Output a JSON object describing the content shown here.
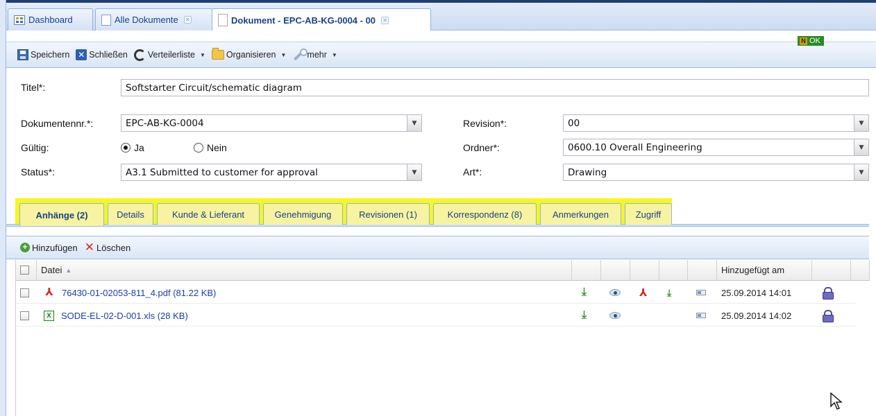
{
  "window_tabs": [
    {
      "label": "Dashboard",
      "icon": "dashboard-icon",
      "closable": false
    },
    {
      "label": "Alle Dokumente",
      "icon": "documents-icon",
      "closable": true
    },
    {
      "label": "Dokument - EPC-AB-KG-0004 - 00",
      "icon": "page-icon",
      "closable": true,
      "active": true
    }
  ],
  "status_badge": {
    "letter": "N",
    "text": "OK",
    "color": "#2a8a26"
  },
  "toolbar": {
    "save": "Speichern",
    "close": "Schließen",
    "distribution": "Verteilerliste",
    "organize": "Organisieren",
    "more": "mehr"
  },
  "form": {
    "title_label": "Titel*:",
    "title_value": "Softstarter Circuit/schematic diagram",
    "docnr_label": "Dokumentennr.*:",
    "docnr_value": "EPC-AB-KG-0004",
    "valid_label": "Gültig:",
    "valid_yes": "Ja",
    "valid_no": "Nein",
    "valid_selected": "Ja",
    "status_label": "Status*:",
    "status_value": "A3.1 Submitted to customer for approval",
    "revision_label": "Revision*:",
    "revision_value": "00",
    "folder_label": "Ordner*:",
    "folder_value": "0600.10 Overall Engineering",
    "type_label": "Art*:",
    "type_value": "Drawing"
  },
  "detail_tabs": [
    {
      "label": "Anhänge (2)",
      "active": true
    },
    {
      "label": "Details"
    },
    {
      "label": "Kunde & Lieferant"
    },
    {
      "label": "Genehmigung"
    },
    {
      "label": "Revisionen (1)"
    },
    {
      "label": "Korrespondenz (8)"
    },
    {
      "label": "Anmerkungen"
    },
    {
      "label": "Zugriff"
    }
  ],
  "highlight_color": "#f6f620",
  "attachments_toolbar": {
    "add": "Hinzufügen",
    "delete": "Löschen"
  },
  "grid": {
    "col_file": "Datei",
    "col_added": "Hinzugefügt am",
    "rows": [
      {
        "file": "76430-01-02053-811_4.pdf (81.22 KB)",
        "type_icon": "pdf-icon",
        "added": "25.09.2014 14:01",
        "actions": [
          "download-icon",
          "view-icon",
          "pdf-sign-icon",
          "approve-icon",
          "properties-icon"
        ]
      },
      {
        "file": "SODE-EL-02-D-001.xls (28 KB)",
        "type_icon": "xls-icon",
        "added": "25.09.2014 14:02",
        "actions": [
          "download-icon",
          "view-icon",
          "properties-icon"
        ]
      }
    ]
  }
}
